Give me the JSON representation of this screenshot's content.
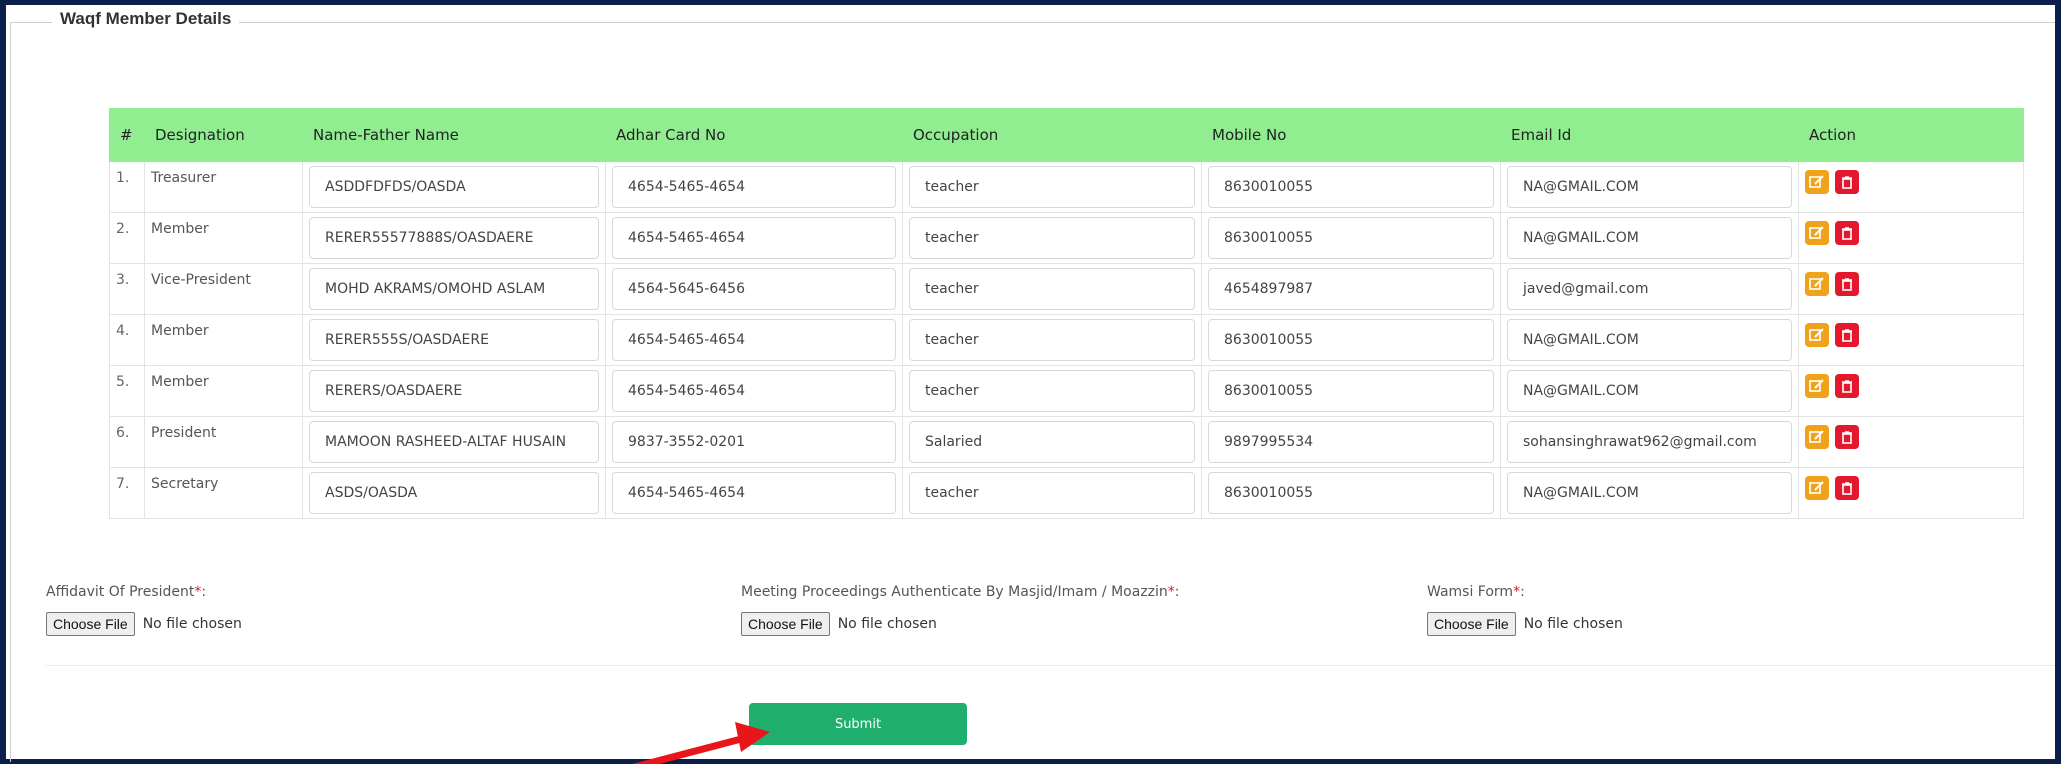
{
  "section": {
    "title": "Waqf Member Details"
  },
  "table": {
    "headers": [
      "#",
      "Designation",
      "Name-Father Name",
      "Adhar Card No",
      "Occupation",
      "Mobile No",
      "Email Id",
      "Action"
    ],
    "rows": [
      {
        "index": "1.",
        "designation": "Treasurer",
        "name": "ASDDFDFDS/OASDA",
        "adhar": "4654-5465-4654",
        "occupation": "teacher",
        "mobile": "8630010055",
        "email": "NA@GMAIL.COM"
      },
      {
        "index": "2.",
        "designation": "Member",
        "name": "RERER55577888S/OASDAERE",
        "adhar": "4654-5465-4654",
        "occupation": "teacher",
        "mobile": "8630010055",
        "email": "NA@GMAIL.COM"
      },
      {
        "index": "3.",
        "designation": "Vice-President",
        "name": "MOHD AKRAMS/OMOHD ASLAM",
        "adhar": "4564-5645-6456",
        "occupation": "teacher",
        "mobile": "4654897987",
        "email": "javed@gmail.com"
      },
      {
        "index": "4.",
        "designation": "Member",
        "name": "RERER555S/OASDAERE",
        "adhar": "4654-5465-4654",
        "occupation": "teacher",
        "mobile": "8630010055",
        "email": "NA@GMAIL.COM"
      },
      {
        "index": "5.",
        "designation": "Member",
        "name": "RERERS/OASDAERE",
        "adhar": "4654-5465-4654",
        "occupation": "teacher",
        "mobile": "8630010055",
        "email": "NA@GMAIL.COM"
      },
      {
        "index": "6.",
        "designation": "President",
        "name": "MAMOON RASHEED-ALTAF HUSAIN",
        "adhar": "9837-3552-0201",
        "occupation": "Salaried",
        "mobile": "9897995534",
        "email": "sohansinghrawat962@gmail.com"
      },
      {
        "index": "7.",
        "designation": "Secretary",
        "name": "ASDS/OASDA",
        "adhar": "4654-5465-4654",
        "occupation": "teacher",
        "mobile": "8630010055",
        "email": "NA@GMAIL.COM"
      }
    ],
    "action_icons": [
      "edit-icon",
      "delete-icon"
    ]
  },
  "uploads": {
    "affidavit_label": "Affidavit Of President",
    "meeting_label": "Meeting Proceedings Authenticate By Masjid/Imam / Moazzin",
    "wamsi_label": "Wamsi Form",
    "required_mark": "*",
    "label_suffix": ":",
    "choose_label": "Choose File",
    "no_file": "No file chosen"
  },
  "submit_label": "Submit",
  "colors": {
    "header_bg": "#90ee90",
    "edit": "#f0a21b",
    "delete": "#e3182d",
    "submit": "#1fae6b",
    "frame": "#0c1f4a",
    "arrow": "#e8161b"
  }
}
